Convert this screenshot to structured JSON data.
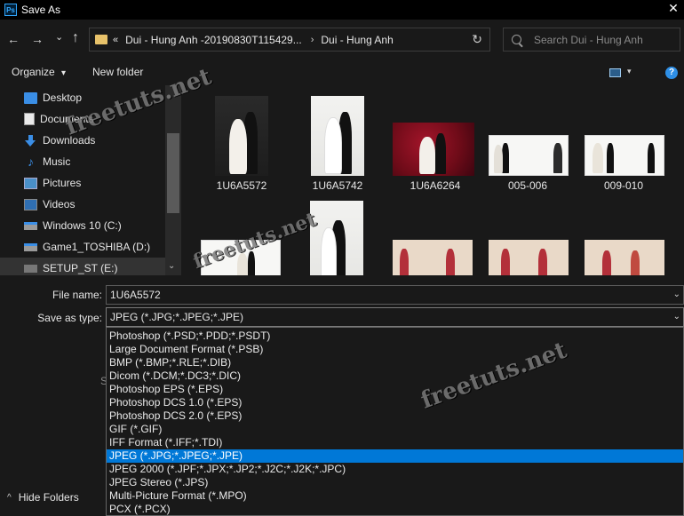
{
  "window": {
    "title": "Save As",
    "app_icon_text": "Ps",
    "close_glyph": "✕"
  },
  "nav": {
    "back_glyph": "←",
    "forward_glyph": "→",
    "recent_glyph": "⌄",
    "up_glyph": "↑",
    "breadcrumb_prefix": "«",
    "breadcrumbs": [
      "Dui - Hung Anh -20190830T115429...",
      "Dui - Hung Anh"
    ],
    "breadcrumb_separator": "›",
    "refresh_glyph": "↻",
    "search_placeholder": "Search Dui - Hung Anh"
  },
  "toolbar": {
    "organize_label": "Organize",
    "organize_caret": "▾",
    "new_folder_label": "New folder",
    "view_caret": "▾",
    "help_glyph": "?"
  },
  "sidebar": {
    "items": [
      {
        "label": "Desktop",
        "icon": "desktop-icon"
      },
      {
        "label": "Documents",
        "icon": "documents-icon"
      },
      {
        "label": "Downloads",
        "icon": "downloads-icon"
      },
      {
        "label": "Music",
        "icon": "music-icon"
      },
      {
        "label": "Pictures",
        "icon": "pictures-icon"
      },
      {
        "label": "Videos",
        "icon": "videos-icon"
      },
      {
        "label": "Windows 10 (C:)",
        "icon": "drive-icon"
      },
      {
        "label": "Game1_TOSHIBA (D:)",
        "icon": "drive-icon"
      },
      {
        "label": "SETUP_ST (E:)",
        "icon": "drive-icon"
      }
    ],
    "selected_index": 8,
    "scroll_down_glyph": "⌄",
    "music_glyph": "♪"
  },
  "files": {
    "row1": [
      "1U6A5572",
      "1U6A5742",
      "1U6A6264",
      "005-006",
      "009-010"
    ]
  },
  "form": {
    "file_name_label": "File name:",
    "file_name_value": "1U6A5572",
    "save_as_type_label": "Save as type:",
    "save_as_type_value": "JPEG (*.JPG;*.JPEG;*.JPE)",
    "dropdown_caret": "⌄",
    "partial_label": "S"
  },
  "type_options": [
    "Photoshop (*.PSD;*.PDD;*.PSDT)",
    "Large Document Format (*.PSB)",
    "BMP (*.BMP;*.RLE;*.DIB)",
    "Dicom (*.DCM;*.DC3;*.DIC)",
    "Photoshop EPS (*.EPS)",
    "Photoshop DCS 1.0 (*.EPS)",
    "Photoshop DCS 2.0 (*.EPS)",
    "GIF (*.GIF)",
    "IFF Format (*.IFF;*.TDI)",
    "JPEG (*.JPG;*.JPEG;*.JPE)",
    "JPEG 2000 (*.JPF;*.JPX;*.JP2;*.J2C;*.J2K;*.JPC)",
    "JPEG Stereo (*.JPS)",
    "Multi-Picture Format (*.MPO)",
    "PCX (*.PCX)"
  ],
  "selected_type_index": 9,
  "footer": {
    "hide_folders_label": "Hide Folders",
    "hide_caret": "^"
  },
  "watermarks": [
    "freetuts.net",
    "freetuts.net",
    "freetuts.net"
  ],
  "colors": {
    "selection": "#0078d7",
    "background": "#191919",
    "accent_blue": "#3a8ee6"
  }
}
